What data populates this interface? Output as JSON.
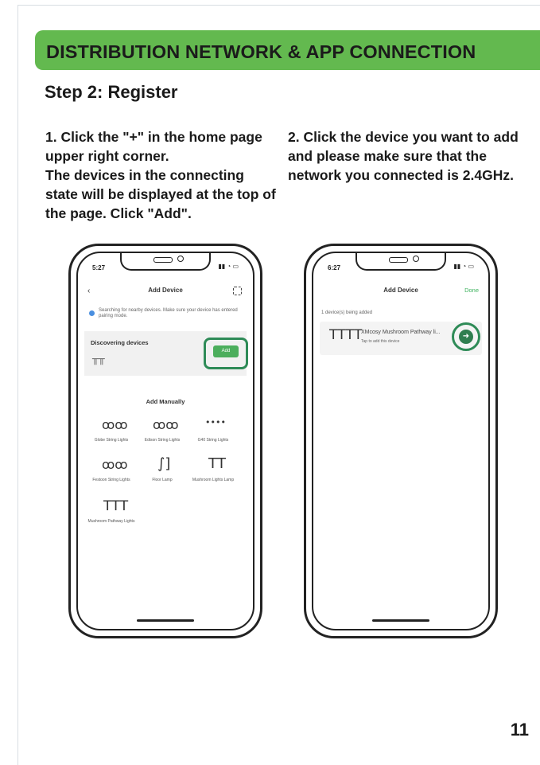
{
  "banner": {
    "title": "DISTRIBUTION NETWORK & APP CONNECTION"
  },
  "step": {
    "title": "Step 2: Register"
  },
  "instructions": {
    "left": [
      "1. Click the \"+\" in the home page upper right corner.",
      "The devices in the connecting state will be displayed at the top of the page. Click \"Add\"."
    ],
    "right": [
      "2. Click the device you want to add and please make sure that the network you connected is 2.4GHz."
    ]
  },
  "phone_left": {
    "time": "5:27",
    "header_title": "Add Device",
    "searching_text": "Searching for nearby devices. Make sure your device has entered pairing mode.",
    "discovering_label": "Discovering devices",
    "add_button": "Add",
    "add_manually_title": "Add Manually",
    "devices": [
      {
        "label": "Globe String Lights",
        "icon": "string-lights-icon"
      },
      {
        "label": "Edison String Lights",
        "icon": "edison-lights-icon"
      },
      {
        "label": "G40 String Lights",
        "icon": "g40-lights-icon"
      },
      {
        "label": "Festoon String Lights",
        "icon": "festoon-lights-icon"
      },
      {
        "label": "Floor Lamp",
        "icon": "floor-lamp-icon"
      },
      {
        "label": "Mushroom Lights Lamp",
        "icon": "mushroom-lamp-icon"
      },
      {
        "label": "Mushroom Pathway Lights",
        "icon": "pathway-lights-icon"
      }
    ]
  },
  "phone_right": {
    "time": "6:27",
    "header_title": "Add Device",
    "done_label": "Done",
    "status_text": "1 device(s) being added",
    "device_name": "XMcosy Mushroom Pathway li...",
    "device_hint": "Tap to add this device"
  },
  "page": {
    "number": "11"
  },
  "colors": {
    "banner": "#63b94f",
    "accent": "#2e8b57",
    "done": "#3fb35f"
  }
}
